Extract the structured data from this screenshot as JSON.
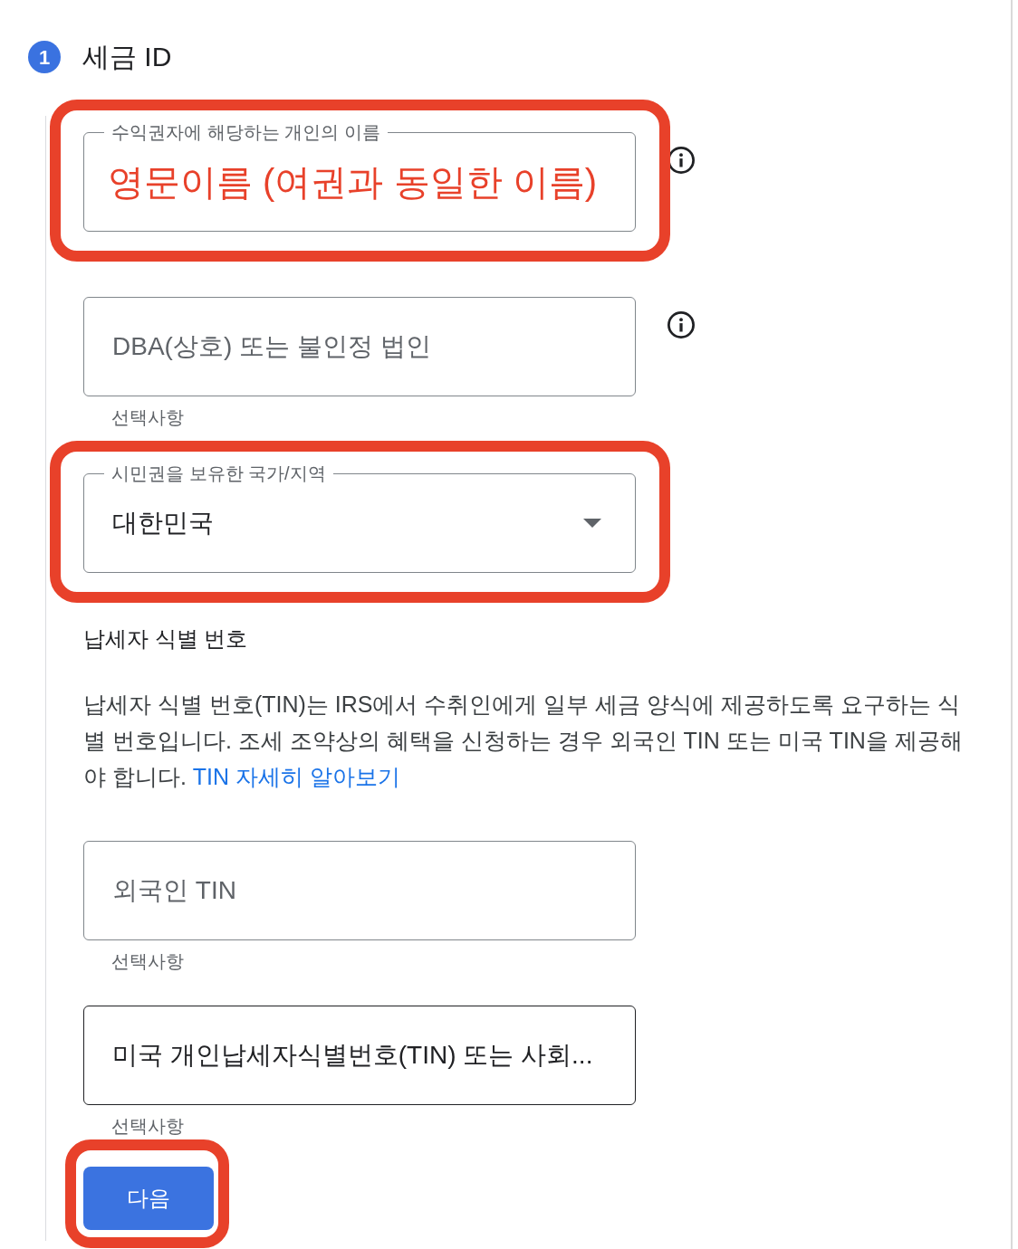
{
  "step": {
    "number": "1",
    "title": "세금 ID"
  },
  "fields": [
    {
      "kind": "text",
      "label": "수익권자에 해당하는 개인의 이름",
      "annotation": "영문이름 (여권과 동일한 이름)",
      "info": true,
      "highlighted": true,
      "hover": false
    },
    {
      "kind": "text",
      "placeholder": "DBA(상호) 또는 불인정 법인",
      "helper": "선택사항",
      "info": true,
      "highlighted": false,
      "hover": false
    },
    {
      "kind": "select",
      "label": "시민권을 보유한 국가/지역",
      "value": "대한민국",
      "info": false,
      "highlighted": true,
      "hover": false
    }
  ],
  "tin_section": {
    "heading": "납세자 식별 번호",
    "description": "납세자 식별 번호(TIN)는 IRS에서 수취인에게 일부 세금 양식에 제공하도록 요구하는 식별 번호입니다. 조세 조약상의 혜택을 신청하는 경우 외국인 TIN 또는 미국 TIN을 제공해야 합니다.",
    "link": "TIN 자세히 알아보기",
    "fields": [
      {
        "kind": "text",
        "placeholder": "외국인 TIN",
        "helper": "선택사항",
        "info": false,
        "highlighted": false,
        "hover": false
      },
      {
        "kind": "text",
        "placeholder": "미국 개인납세자식별번호(TIN) 또는 사회...",
        "helper": "선택사항",
        "info": false,
        "highlighted": false,
        "hover": true
      }
    ]
  },
  "next_button": {
    "label": "다음",
    "highlighted": true
  }
}
